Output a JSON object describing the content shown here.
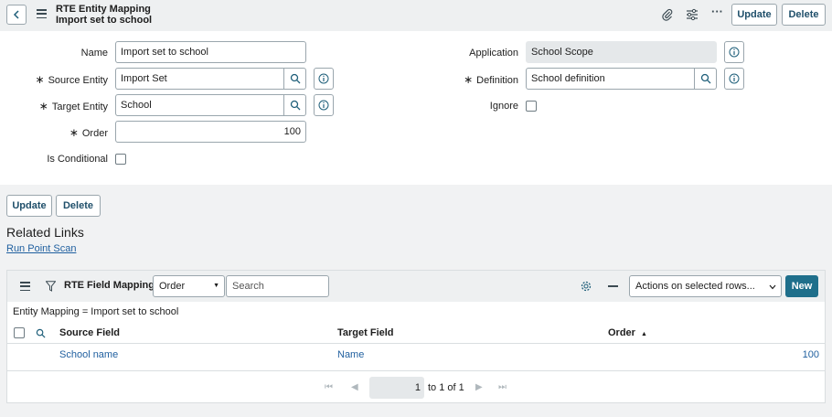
{
  "header": {
    "title_line1": "RTE Entity Mapping",
    "title_line2": "Import set to school",
    "update_label": "Update",
    "delete_label": "Delete"
  },
  "form": {
    "name_label": "Name",
    "name_value": "Import set to school",
    "source_entity_label": "Source Entity",
    "source_entity_value": "Import Set",
    "target_entity_label": "Target Entity",
    "target_entity_value": "School",
    "order_label": "Order",
    "order_value": "100",
    "is_conditional_label": "Is Conditional",
    "application_label": "Application",
    "application_value": "School Scope",
    "definition_label": "Definition",
    "definition_value": "School definition",
    "ignore_label": "Ignore",
    "required_mark": "∗"
  },
  "actions": {
    "update_label": "Update",
    "delete_label": "Delete"
  },
  "related_links": {
    "title": "Related Links",
    "links": [
      "Run Point Scan"
    ]
  },
  "related_list": {
    "title": "RTE Field Mappings",
    "search_field_select": "Order",
    "search_placeholder": "Search",
    "actions_select": "Actions on selected rows...",
    "new_label": "New",
    "filter_text": "Entity Mapping = Import set to school",
    "columns": [
      "Source Field",
      "Target Field",
      "Order"
    ],
    "sort_indicator": "▲",
    "rows": [
      {
        "source_field": "School name",
        "target_field": "Name",
        "order": "100"
      }
    ],
    "pagination": {
      "current_page": "1",
      "summary": "to 1 of 1"
    }
  },
  "colors": {
    "accent": "#1f6f8b",
    "link": "#1f5f9f",
    "header_bg": "#eef0f1"
  }
}
